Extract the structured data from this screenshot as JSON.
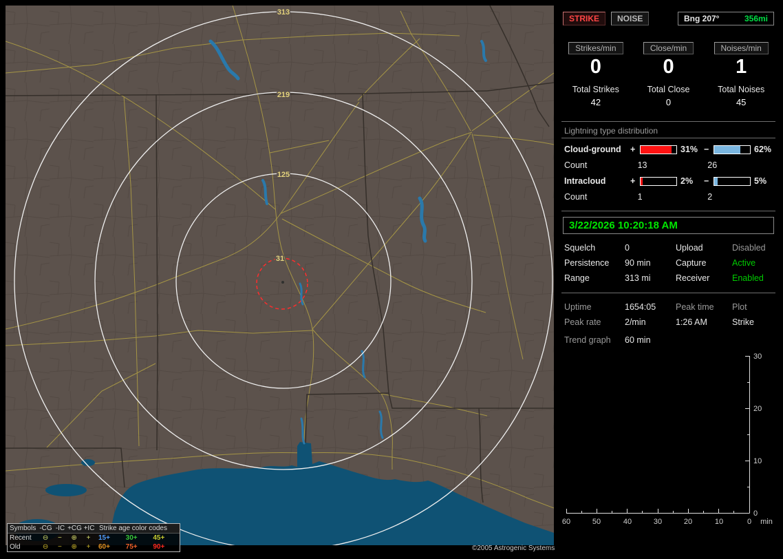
{
  "map": {
    "ring_labels": [
      "313",
      "219",
      "125",
      "31"
    ],
    "copyright": "©2005 Astrogenic Systems",
    "legend": {
      "symbols_title": "Symbols",
      "columns": [
        "-CG",
        "-IC",
        "+CG",
        "+IC"
      ],
      "symbols": [
        "⊖",
        "−",
        "⊕",
        "+"
      ],
      "age_title": "Strike age color codes",
      "rows": [
        {
          "label": "Recent",
          "symbol_color": "#d6dc6a",
          "ages": [
            {
              "t": "15+",
              "c": "#4f9fff"
            },
            {
              "t": "30+",
              "c": "#38c838"
            },
            {
              "t": "45+",
              "c": "#c8cc30"
            }
          ]
        },
        {
          "label": "Old",
          "symbol_color": "#cbb42a",
          "ages": [
            {
              "t": "60+",
              "c": "#e09020"
            },
            {
              "t": "75+",
              "c": "#f06028"
            },
            {
              "t": "90+",
              "c": "#ff2a20"
            }
          ]
        }
      ]
    }
  },
  "panel": {
    "colors": {
      "accent_green": "#00e600",
      "strike_red": "#ff4545",
      "bar_red": "#ff1212",
      "bar_blue": "#7ab6e0",
      "ring_white": "#f0f0f0",
      "map_land": "#5c524c",
      "map_water": "#0f5274"
    },
    "strike_label": "STRIKE",
    "noise_label": "NOISE",
    "bearing_label": "Bng 207°",
    "bearing_range": "356mi",
    "rate_boxes": [
      {
        "label": "Strikes/min",
        "value": "0"
      },
      {
        "label": "Close/min",
        "value": "0"
      },
      {
        "label": "Noises/min",
        "value": "1"
      }
    ],
    "totals": [
      {
        "label": "Total Strikes",
        "value": "42"
      },
      {
        "label": "Total Close",
        "value": "0"
      },
      {
        "label": "Total Noises",
        "value": "45"
      }
    ],
    "distribution": {
      "title": "Lightning type distribution",
      "cloud_ground": {
        "label": "Cloud-ground",
        "plus_sign": "+",
        "plus_pct": "31%",
        "plus_fill": 86,
        "minus_sign": "−",
        "minus_pct": "62%",
        "minus_fill": 74,
        "count_label": "Count",
        "plus_count": "13",
        "minus_count": "26"
      },
      "intracloud": {
        "label": "Intracloud",
        "plus_sign": "+",
        "plus_pct": "2%",
        "plus_fill": 6,
        "minus_sign": "−",
        "minus_pct": "5%",
        "minus_fill": 10,
        "count_label": "Count",
        "plus_count": "1",
        "minus_count": "2"
      }
    },
    "timestamp": "3/22/2026 10:20:18 AM",
    "settings": {
      "squelch_label": "Squelch",
      "squelch": "0",
      "persistence_label": "Persistence",
      "persistence": "90 min",
      "range_label": "Range",
      "range": "313 mi",
      "upload_label": "Upload",
      "upload": "Disabled",
      "capture_label": "Capture",
      "capture": "Active",
      "receiver_label": "Receiver",
      "receiver": "Enabled"
    },
    "status": {
      "uptime_label": "Uptime",
      "uptime": "1654:05",
      "peak_time_label": "Peak time",
      "plot_label": "Plot",
      "peak_rate_label": "Peak rate",
      "peak_rate": "2/min",
      "peak_time": "1:26 AM",
      "plot": "Strike",
      "trend_label": "Trend graph",
      "trend_value": "60 min"
    },
    "trend_graph": {
      "y_ticks": [
        "30",
        "20",
        "10",
        "0"
      ],
      "x_ticks": [
        "60",
        "50",
        "40",
        "30",
        "20",
        "10",
        "0"
      ],
      "x_unit": "min"
    }
  }
}
